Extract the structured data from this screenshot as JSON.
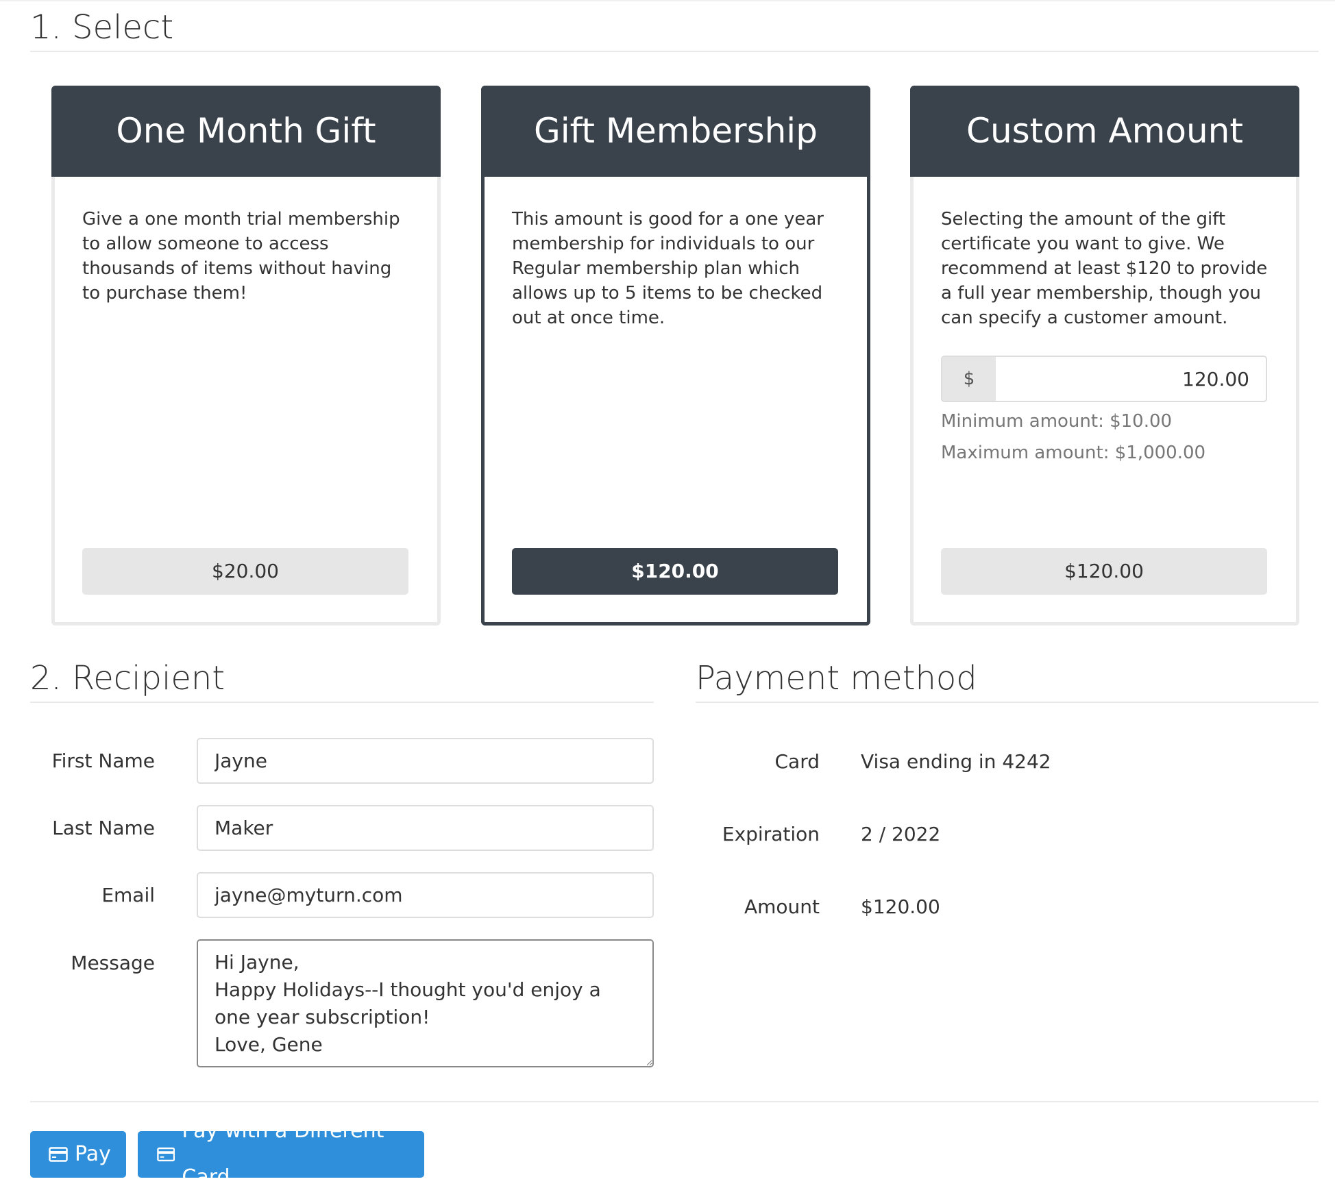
{
  "select": {
    "title": "1. Select",
    "cards": [
      {
        "title": "One Month Gift",
        "description": "Give a one month trial membership to allow someone to access thousands of items without having to purchase them!",
        "price": "$20.00"
      },
      {
        "title": "Gift Membership",
        "description": "This amount is good for a one year membership for individuals to our Regular membership plan which allows up to 5 items to be checked out at once time.",
        "price": "$120.00"
      },
      {
        "title": "Custom Amount",
        "description": "Selecting the amount of the gift certificate you want to give. We recommend at least $120 to provide a full year membership, though you can specify a customer amount.",
        "currency_symbol": "$",
        "amount_value": "120.00",
        "min_text": "Minimum amount: $10.00",
        "max_text": "Maximum amount: $1,000.00",
        "price": "$120.00"
      }
    ]
  },
  "recipient": {
    "title": "2. Recipient",
    "first_name_label": "First Name",
    "first_name_value": "Jayne",
    "last_name_label": "Last Name",
    "last_name_value": "Maker",
    "email_label": "Email",
    "email_value": "jayne@myturn.com",
    "message_label": "Message",
    "message_value": "Hi Jayne,\nHappy Holidays--I thought you'd enjoy a one year subscription!\nLove, Gene"
  },
  "payment": {
    "title": "Payment method",
    "card_label": "Card",
    "card_value": "Visa ending in 4242",
    "expiration_label": "Expiration",
    "expiration_value": "2 / 2022",
    "amount_label": "Amount",
    "amount_value": "$120.00"
  },
  "actions": {
    "pay_label": "Pay",
    "pay_different_label": "Pay with a Different Card"
  },
  "colors": {
    "accent": "#2f8fdb",
    "card_header": "#3a424b"
  }
}
